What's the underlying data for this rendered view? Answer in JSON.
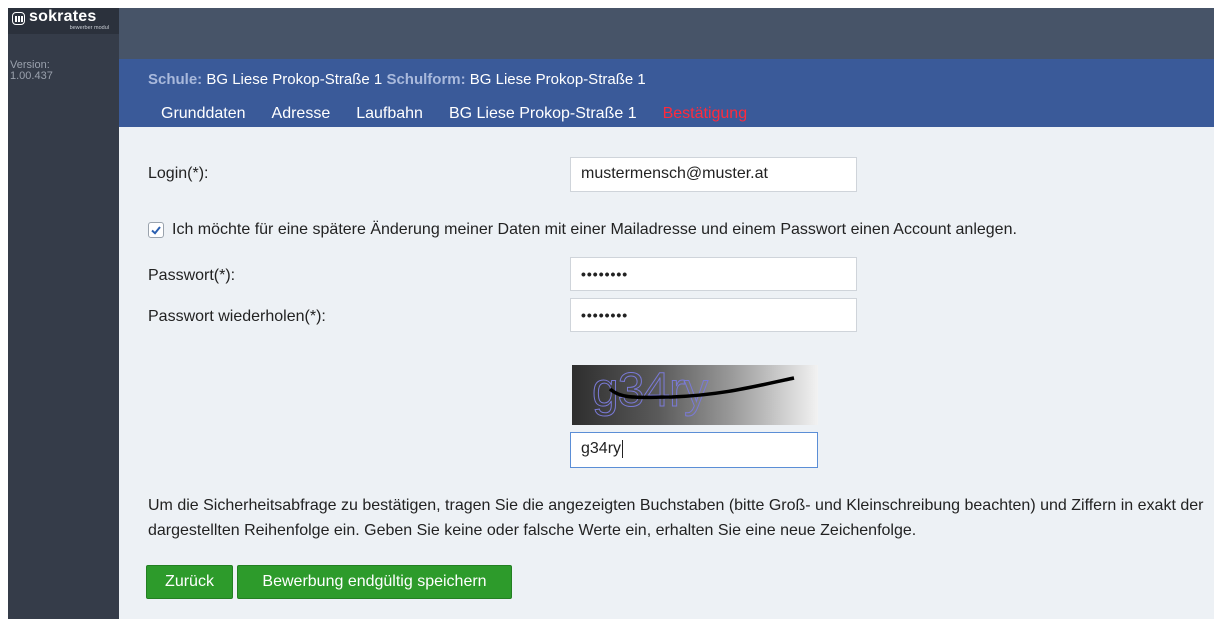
{
  "sidebar": {
    "logo_text": "sokrates",
    "logo_sub": "bewerber modul",
    "version_label": "Version:",
    "version_number": "1.00.437"
  },
  "header": {
    "school_label": "Schule:",
    "school_value": "BG Liese Prokop-Straße 1",
    "schoolform_label": "Schulform:",
    "schoolform_value": "BG Liese Prokop-Straße 1",
    "tabs": [
      {
        "label": "Grunddaten"
      },
      {
        "label": "Adresse"
      },
      {
        "label": "Laufbahn"
      },
      {
        "label": "BG Liese Prokop-Straße 1"
      },
      {
        "label": "Bestätigung"
      }
    ]
  },
  "form": {
    "login_label": "Login(*):",
    "login_value": "mustermensch@muster.at",
    "account_checkbox_label": "Ich möchte für eine spätere Änderung meiner Daten mit einer Mailadresse und einem Passwort einen Account anlegen.",
    "account_checkbox_checked": true,
    "password_label": "Passwort(*):",
    "password_value": "••••••••",
    "password_repeat_label": "Passwort wiederholen(*):",
    "password_repeat_value": "••••••••",
    "captcha_text": "g34ry",
    "captcha_input_value": "g34ry",
    "info_text": "Um die Sicherheitsabfrage zu bestätigen, tragen Sie die angezeigten Buchstaben (bitte Groß- und Kleinschreibung beachten) und Ziffern in exakt der dargestellten Reihenfolge ein. Geben Sie keine oder falsche Werte ein, erhalten Sie eine neue Zeichenfolge."
  },
  "buttons": {
    "back_label": "Zurück",
    "save_label": "Bewerbung endgültig speichern"
  },
  "colors": {
    "sidebar": "#353c49",
    "topbar": "#475468",
    "schoolbar": "#3a5a99",
    "active_tab": "#ff2a3c",
    "content_bg": "#edf1f5",
    "button": "#2d9b2b"
  }
}
